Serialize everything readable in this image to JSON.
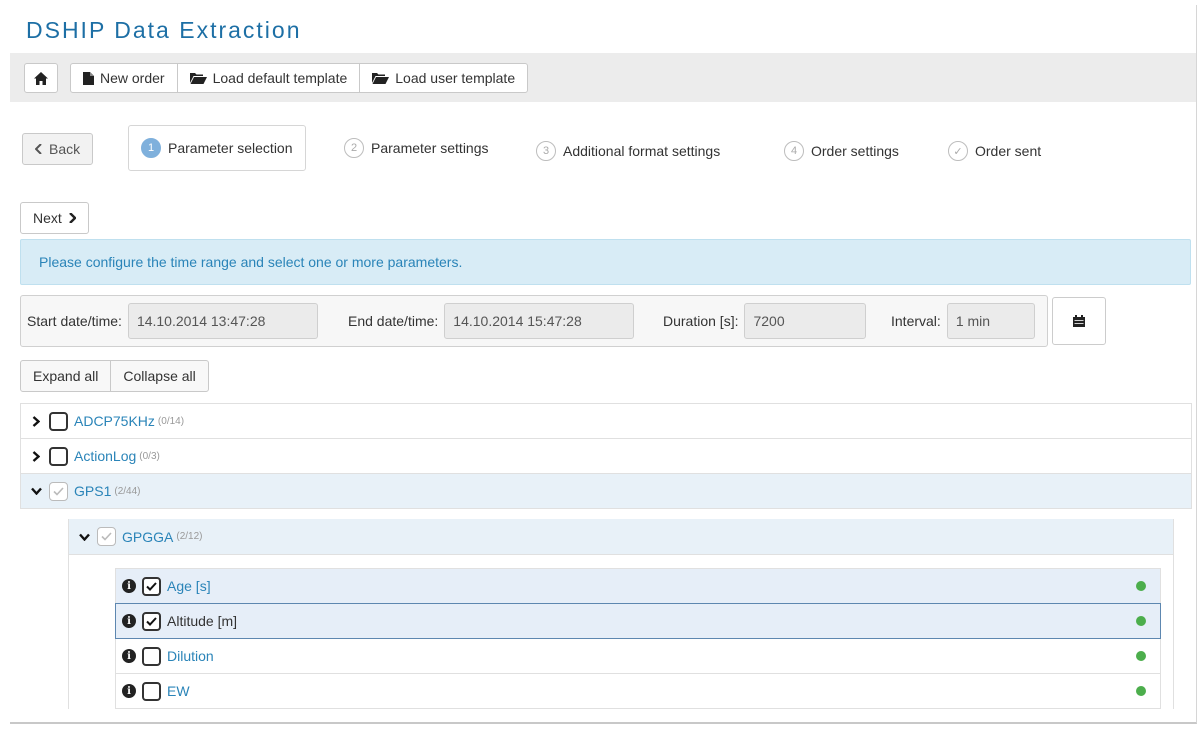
{
  "app_title": "DSHIP Data Extraction",
  "toolbar": {
    "home_icon": "home-icon",
    "new_order": "New order",
    "load_default": "Load default template",
    "load_user": "Load user template"
  },
  "wizard": {
    "back": "Back",
    "steps": [
      {
        "num": "1",
        "label": "Parameter selection",
        "active": true
      },
      {
        "num": "2",
        "label": "Parameter settings"
      },
      {
        "num": "3",
        "label": "Additional format settings"
      },
      {
        "num": "4",
        "label": "Order settings"
      },
      {
        "num": "✓",
        "label": "Order sent"
      }
    ],
    "next": "Next"
  },
  "info_message": "Please configure the time range and select one or more parameters.",
  "time_range": {
    "start_label": "Start date/time:",
    "start_value": "14.10.2014 13:47:28",
    "end_label": "End date/time:",
    "end_value": "14.10.2014 15:47:28",
    "duration_label": "Duration [s]:",
    "duration_value": "7200",
    "interval_label": "Interval:",
    "interval_value": "1 min"
  },
  "tree_controls": {
    "expand_all": "Expand all",
    "collapse_all": "Collapse all"
  },
  "tree": {
    "nodes": [
      {
        "name": "ADCP75KHz",
        "count": "(0/14)"
      },
      {
        "name": "ActionLog",
        "count": "(0/3)"
      },
      {
        "name": "GPS1",
        "count": "(2/44)"
      }
    ],
    "sub": {
      "name": "GPGGA",
      "count": "(2/12)"
    },
    "leaves": [
      {
        "name": "Age [s]",
        "checked": true
      },
      {
        "name": "Altitude [m]",
        "checked": true
      },
      {
        "name": "Dilution",
        "checked": false
      },
      {
        "name": "EW",
        "checked": false
      }
    ]
  },
  "colors": {
    "accent": "#2a84b8",
    "title": "#1d6fa5",
    "status_ok": "#4cae4c",
    "info_bg": "#d8ecf6"
  }
}
